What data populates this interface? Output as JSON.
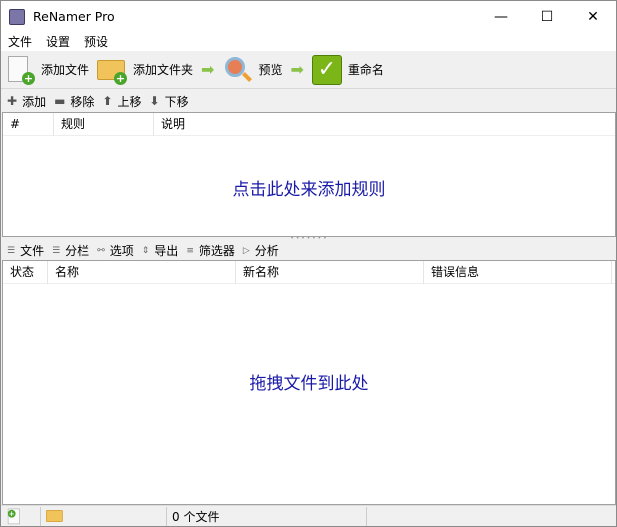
{
  "window": {
    "title": "ReNamer Pro",
    "minimize": "—",
    "maximize": "☐",
    "close": "✕"
  },
  "menu": [
    "文件",
    "设置",
    "预设"
  ],
  "toolbar": {
    "add_files": "添加文件",
    "add_folder": "添加文件夹",
    "preview": "预览",
    "rename": "重命名"
  },
  "rules_toolbar": {
    "add": "添加",
    "remove": "移除",
    "up": "上移",
    "down": "下移"
  },
  "rules": {
    "columns": [
      "#",
      "规则",
      "说明"
    ],
    "empty_hint": "点击此处来添加规则"
  },
  "files_toolbar": [
    "文件",
    "分栏",
    "选项",
    "导出",
    "筛选器",
    "分析"
  ],
  "files": {
    "columns": [
      "状态",
      "名称",
      "新名称",
      "错误信息"
    ],
    "empty_hint": "拖拽文件到此处"
  },
  "status": {
    "count": "0 个文件"
  }
}
